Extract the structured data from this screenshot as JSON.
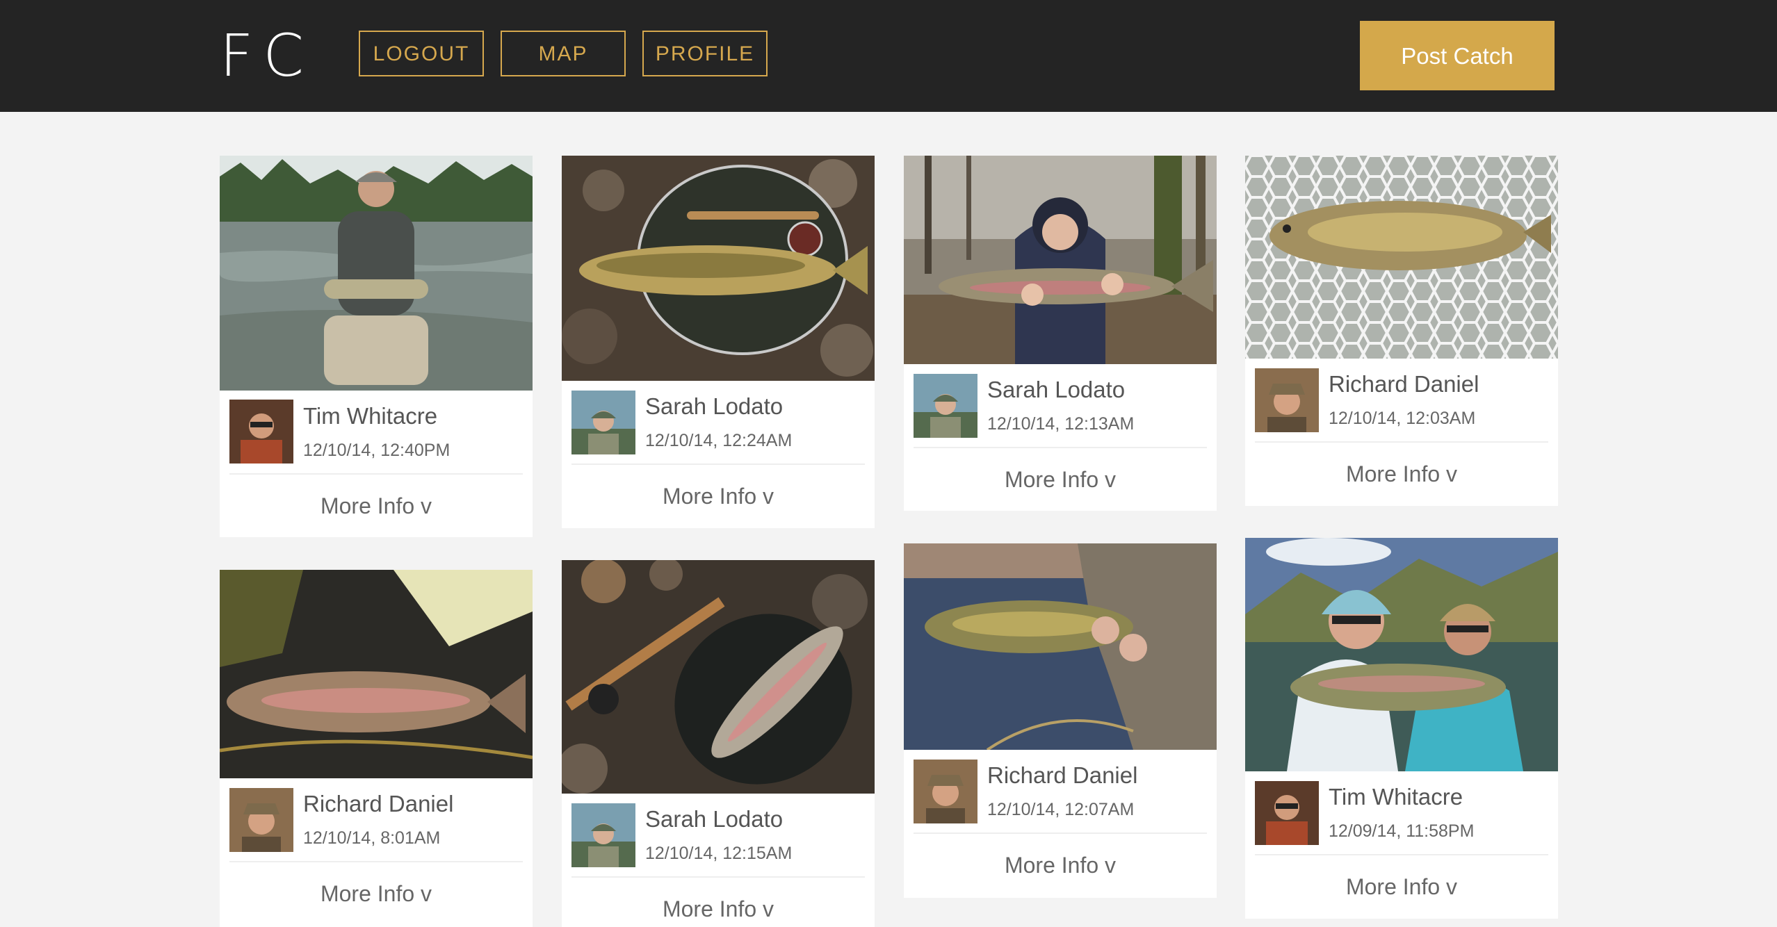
{
  "header": {
    "logo": "FC",
    "nav": {
      "logout": "LOGOUT",
      "map": "MAP",
      "profile": "PROFILE"
    },
    "post_catch": "Post Catch"
  },
  "colors": {
    "topbar": "#242424",
    "accent": "#d6a84e",
    "page_bg": "#f3f3f3"
  },
  "catches": [
    {
      "user": "Tim Whitacre",
      "date": "12/10/14, 12:40PM",
      "more": "More Info v"
    },
    {
      "user": "Sarah Lodato",
      "date": "12/10/14, 12:24AM",
      "more": "More Info v"
    },
    {
      "user": "Sarah Lodato",
      "date": "12/10/14, 12:13AM",
      "more": "More Info v"
    },
    {
      "user": "Richard Daniel",
      "date": "12/10/14, 12:03AM",
      "more": "More Info v"
    },
    {
      "user": "Richard Daniel",
      "date": "12/10/14, 8:01AM",
      "more": "More Info v"
    },
    {
      "user": "Sarah Lodato",
      "date": "12/10/14, 12:15AM",
      "more": "More Info v"
    },
    {
      "user": "Richard Daniel",
      "date": "12/10/14, 12:07AM",
      "more": "More Info v"
    },
    {
      "user": "Tim Whitacre",
      "date": "12/09/14, 11:58PM",
      "more": "More Info v"
    }
  ]
}
